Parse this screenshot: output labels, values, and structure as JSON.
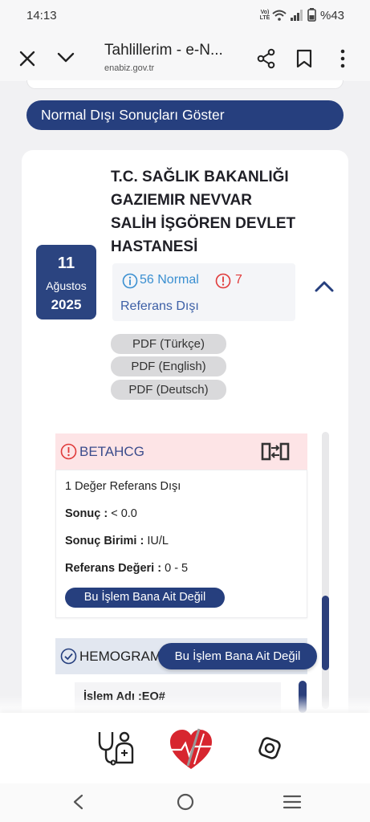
{
  "status_bar": {
    "time": "14:13",
    "network_top": "Vo)",
    "network_bottom": "LTE",
    "battery": "%43"
  },
  "browser": {
    "title": "Tahlillerim - e-N...",
    "url": "enabiz.gov.tr"
  },
  "filter_button_label": "Normal Dışı Sonuçları Göster",
  "hospital": {
    "name_lines": [
      "T.C. SAĞLIK BAKANLIĞI",
      "GAZIEMIR NEVVAR",
      "SALİH İŞGÖREN DEVLET",
      "HASTANESİ"
    ],
    "date": {
      "day": "11",
      "month": "Ağustos",
      "year": "2025"
    },
    "summary": {
      "normal": "56 Normal",
      "abnormal_count": "7",
      "abnormal_label": "Referans Dışı"
    },
    "pdf_buttons": [
      {
        "label": "PDF (Türkçe)"
      },
      {
        "label": "PDF (English)"
      },
      {
        "label": "PDF (Deutsch)"
      }
    ]
  },
  "results": [
    {
      "test": "BETAHCG",
      "status": "out-of-range",
      "note": "1 Değer Referans Dışı",
      "fields": [
        {
          "label": "Sonuç :",
          "value": " < 0.0"
        },
        {
          "label": "Sonuç Birimi :",
          "value": " IU/L"
        },
        {
          "label": "Referans Değeri :",
          "value": " 0 - 5"
        }
      ],
      "action_label": "Bu İşlem Bana Ait Değil"
    },
    {
      "test": "HEMOGRAM",
      "status": "normal",
      "action_label": "Bu İşlem Bana Ait Değil",
      "fields": [
        {
          "label": "İslem Adı :",
          "value": "EO#"
        }
      ]
    }
  ],
  "colors": {
    "navy": "#263f7e",
    "info_blue": "#3a8fd1",
    "alert_red": "#e03a3a",
    "alert_bg": "#fde4e6",
    "normal_bg": "#e2e7f0"
  }
}
